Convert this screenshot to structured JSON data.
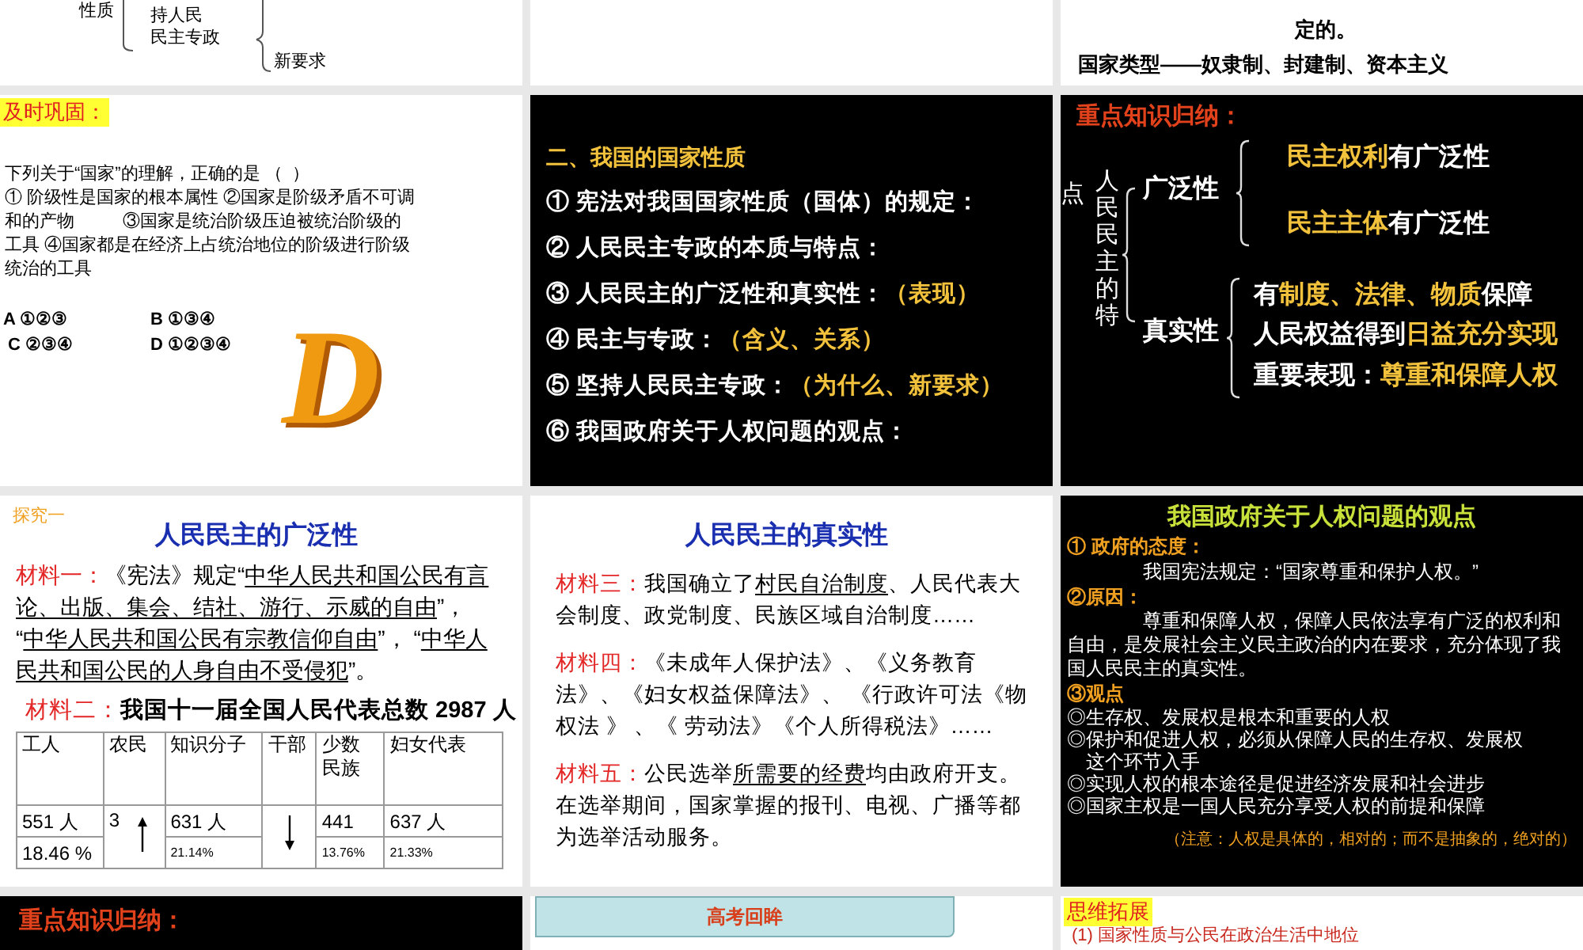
{
  "slides": [
    {
      "kind": "outline_fragment",
      "dark": false,
      "items": [
        "性质",
        "持人民",
        "民主专政",
        "新要求"
      ]
    },
    {
      "kind": "blank",
      "dark": false
    },
    {
      "kind": "statement",
      "dark": false,
      "lines": [
        "定的。",
        "国家类型——奴隶制、封建制、资本主义"
      ]
    },
    {
      "kind": "quiz",
      "dark": false,
      "badge": "及时巩固：",
      "question": [
        "下列关于“国家”的理解，正确的是 （  ）",
        "① 阶级性是国家的根本属性 ②国家是阶级矛盾不可调",
        "和的产物          ③国家是统治阶级压迫被统治阶级的",
        "工具 ④国家都是在经济上占统治地位的阶级进行阶级",
        "统治的工具"
      ],
      "options": [
        "A ①②③",
        "B ①③④",
        " C ②③④",
        "D ①②③④"
      ],
      "answer": "D"
    },
    {
      "kind": "topic_list",
      "dark": true,
      "lines": [
        [
          {
            "kind": "accent",
            "text": "二、我国的国家性质"
          }
        ],
        [
          {
            "kind": "plain",
            "text": "① 宪法对我国国家性质（国体）的规定："
          }
        ],
        [
          {
            "kind": "plain",
            "text": "② 人民民主专政的本质与特点："
          }
        ],
        [
          {
            "kind": "plain",
            "text": "③ 人民民主的广泛性和真实性："
          },
          {
            "kind": "accent",
            "text": "（表现）"
          }
        ],
        [
          {
            "kind": "plain",
            "text": "④  民主与专政："
          },
          {
            "kind": "accent",
            "text": "（含义、关系）"
          }
        ],
        [
          {
            "kind": "plain",
            "text": "⑤  坚持人民民主专政："
          },
          {
            "kind": "accent",
            "text": "（为什么、新要求）"
          }
        ],
        [
          {
            "kind": "plain",
            "text": "⑥  我国政府关于人权问题的观点："
          }
        ]
      ]
    },
    {
      "kind": "knowledge_tree",
      "dark": true,
      "title": "重点知识归纳：",
      "side": "点",
      "root": "人民民主的特",
      "branches": [
        {
          "label": "广泛性",
          "points": [
            [
              {
                "kind": "accent",
                "text": "民主权利"
              },
              {
                "kind": "plain",
                "text": "有广泛性"
              }
            ],
            [
              {
                "kind": "accent",
                "text": "民主主体"
              },
              {
                "kind": "plain",
                "text": "有广泛性"
              }
            ]
          ]
        },
        {
          "label": "真实性",
          "points": [
            [
              {
                "kind": "plain",
                "text": "有"
              },
              {
                "kind": "accent",
                "text": "制度、法律、物质"
              },
              {
                "kind": "plain",
                "text": "保障"
              }
            ],
            [
              {
                "kind": "plain",
                "text": "人民权益得到"
              },
              {
                "kind": "accent",
                "text": "日益充分实现"
              }
            ],
            [
              {
                "kind": "plain",
                "text": "重要表现："
              },
              {
                "kind": "accent",
                "text": "尊重和保障人权"
              }
            ]
          ]
        }
      ]
    },
    {
      "kind": "material_table",
      "dark": false,
      "tag": "探究一",
      "title": "人民民主的广泛性",
      "material": [
        {
          "kind": "label",
          "text": "材料一："
        },
        {
          "kind": "plain",
          "text": "《宪法》规定“"
        },
        {
          "kind": "underline",
          "text": "中华人民共和国公民有言论、出版、集会、结社、游行、示威的自由"
        },
        {
          "kind": "plain",
          "text": "”，    “"
        },
        {
          "kind": "underline",
          "text": "中华人民共和国公民有宗教信仰自由"
        },
        {
          "kind": "plain",
          "text": "”，    “"
        },
        {
          "kind": "underline",
          "text": "中华人民共和国公民的人身自由不受侵犯"
        },
        {
          "kind": "plain",
          "text": "”。"
        }
      ],
      "caption": [
        {
          "kind": "label",
          "text": "材料二："
        },
        {
          "kind": "bold",
          "text": "我国十一届全国人民代表总数 2987 人"
        }
      ],
      "table": [
        {
          "kind": "number",
          "header": "工人",
          "count": "551 人",
          "share": "18.46 %"
        },
        {
          "kind": "rising",
          "header": "农民",
          "count": "3"
        },
        {
          "kind": "number",
          "header": "知识分子",
          "count": "631 人",
          "share": "21.14%"
        },
        {
          "kind": "falling",
          "header": "干部"
        },
        {
          "kind": "number",
          "header": "少数民族",
          "count": "441",
          "share": "13.76%"
        },
        {
          "kind": "number",
          "header": "妇女代表",
          "count": "637 人",
          "share": "21.33%"
        }
      ]
    },
    {
      "kind": "material_text",
      "dark": false,
      "title": "人民民主的真实性",
      "paragraphs": [
        [
          {
            "kind": "label",
            "text": "材料三："
          },
          {
            "kind": "plain",
            "text": "我国确立了"
          },
          {
            "kind": "underline",
            "text": "村民自治制度"
          },
          {
            "kind": "plain",
            "text": "、人民代表大会制度、政党制度、民族区域自治制度……"
          }
        ],
        [
          {
            "kind": "label",
            "text": "材料四："
          },
          {
            "kind": "plain",
            "text": "《未成年人保护法》、《义务教育法》、《妇女权益保障法》、 《行政许可法《物权法 》 、《  劳动法》《个人所得税法》……"
          }
        ],
        [
          {
            "kind": "label",
            "text": "材料五："
          },
          {
            "kind": "plain",
            "text": "公民选举"
          },
          {
            "kind": "underline",
            "text": "所需要的经费"
          },
          {
            "kind": "plain",
            "text": "均由政府开支。在选举期间，国家掌握的报刊、电视、广播等都为选举活动服务。"
          }
        ]
      ]
    },
    {
      "kind": "viewpoints",
      "dark": true,
      "lines": [
        {
          "kind": "title",
          "text": "我国政府关于人权问题的观点"
        },
        {
          "kind": "heading",
          "text": "① 政府的态度："
        },
        {
          "kind": "quote",
          "text": "我国宪法规定：“国家尊重和保护人权。”"
        },
        {
          "kind": "heading",
          "text": "②原因："
        },
        {
          "kind": "body",
          "text": "尊重和保障人权，保障人民依法享有广泛的权利和自由，是发展社会主义民主政治的内在要求，充分体现了我国人民民主的真实性。"
        },
        {
          "kind": "heading",
          "text": "③观点"
        },
        {
          "kind": "bullet",
          "text": "◎生存权、发展权是根本和重要的人权"
        },
        {
          "kind": "bullet",
          "text": "◎保护和促进人权，必须从保障人民的生存权、发展权这个环节入手"
        },
        {
          "kind": "bullet",
          "text": "◎实现人权的根本途径是促进经济发展和社会进步"
        },
        {
          "kind": "bullet",
          "text": "◎国家主权是一国人民充分享受人权的前提和保障"
        },
        {
          "kind": "note",
          "text": "（注意：人权是具体的，相对的；而不是抽象的，绝对的）"
        }
      ]
    },
    {
      "kind": "section_title",
      "dark": true,
      "title": "重点知识归纳："
    },
    {
      "kind": "banner",
      "dark": false,
      "title": "高考回眸"
    },
    {
      "kind": "extension",
      "dark": false,
      "badge": "思维拓展",
      "lines": [
        "(1) 国家性质与公民在政治生活中地位"
      ]
    }
  ]
}
